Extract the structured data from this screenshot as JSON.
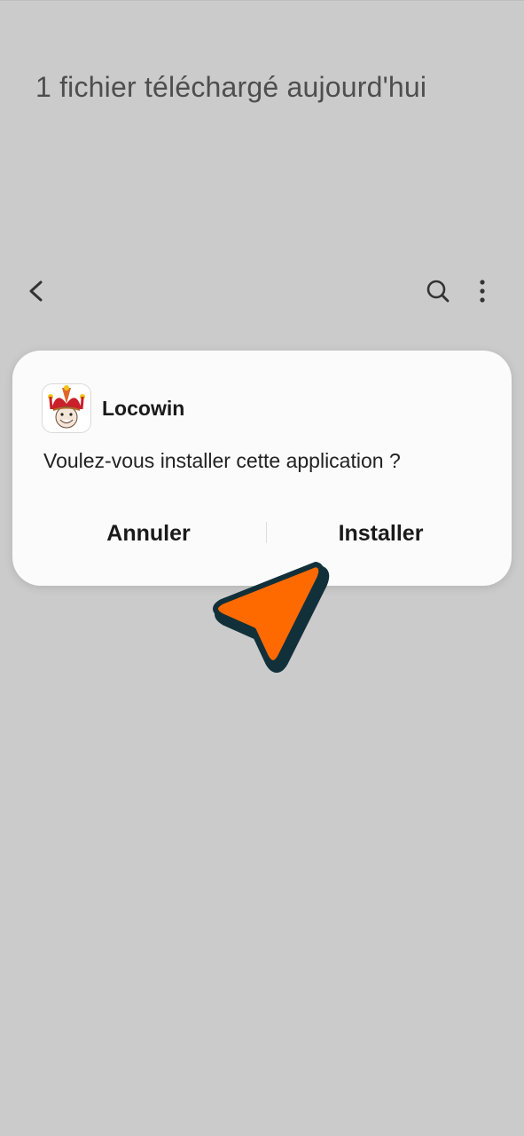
{
  "page": {
    "title": "1 fichier téléchargé aujourd'hui"
  },
  "toolbar": {
    "back_icon": "chevron-left-icon",
    "search_icon": "search-icon",
    "more_icon": "more-vertical-icon"
  },
  "dialog": {
    "app_icon": "jester-app-icon",
    "app_name": "Locowin",
    "question": "Voulez-vous installer cette application ?",
    "cancel_label": "Annuler",
    "install_label": "Installer"
  },
  "overlay": {
    "pointer_icon": "arrow-pointer-icon",
    "pointer_color": "#ff6a00",
    "pointer_outline": "#12303a"
  },
  "colors": {
    "background": "#cbcbcb",
    "dialog_bg": "#fbfbfb",
    "text": "#1a1a1a"
  }
}
